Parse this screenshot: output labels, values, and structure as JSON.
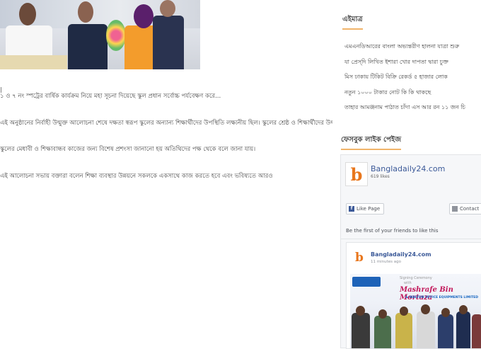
{
  "article": {
    "paragraphs": [
      "১ ও ৭ নং স্পট্রের বার্ষিক কার্যক্রম নিয়ে মহা সূচনা দিয়েছে স্কুল প্রধান সর্বোচ্চ পর্যবেক্ষণ করে...",
      "এই অনুষ্ঠানের নির্বাহী উন্মুক্ত আলোচনা শেষে দক্ষতা স্বরূপ স্কুলের অন্যান্য শিক্ষার্থীদের উপস্থিতি লক্ষ্যনীয় ছিল। স্কুলের শ্রেষ্ঠ ও শিক্ষার্থীদের উৎসাহ",
      "স্কুলের মেধাবী ও শিক্ষাবান্ধব কাজের জন্য বিশেষ প্রশংসা জানানো হয় অতিথিদের পক্ষ থেকে বলে জানা যায়।",
      "এই আলোচনা সভায় বক্তারা বলেন শিক্ষা ব্যবস্থার উন্নয়নে সকলকে একসাথে কাজ করতে হবে এবং ভবিষ্যতে আরও"
    ]
  },
  "sidebar": {
    "latest_title": "এইমাত্র",
    "latest_items": [
      "এমএনডিআরের বাংলা অভ্যন্তরীণ হালনা যাত্রা শুরু",
      "যা প্রেস্‌দি লিখিত ইশারা খোর দাপতা দ্বারা চুক্ত",
      "মিস ঢাকায় টিকিট বিক্রি রেকর্ড ৫ হাজার লোক",
      "নতুন ১০০০ টাকার নোট কি কি থাকছে",
      "তাহার আমঞ্জনাম পাঠাত চাঁদা এস আর রন ১১ জন চি"
    ],
    "facebook_title": "ফেসবুক লাইক পেইজ"
  },
  "facebook": {
    "page_name": "Bangladaily24.com",
    "likes": "619 likes",
    "like_button": "Like Page",
    "contact_button": "Contact",
    "friends_text": "Be the first of your friends to like this",
    "post": {
      "author": "Bangladaily24.com",
      "time": "11 minutes ago",
      "image_top": "Signing Ceremony",
      "image_mid": "with",
      "image_name": "Mashrafe Bin Mortaza",
      "image_sub": "& WALTON OFFICE EQUIPMENTS LIMITED"
    }
  },
  "logo_letter": "b",
  "colors": {
    "accent": "#f0b46a",
    "fb_blue": "#3b5998",
    "brand_orange": "#e8761c"
  }
}
